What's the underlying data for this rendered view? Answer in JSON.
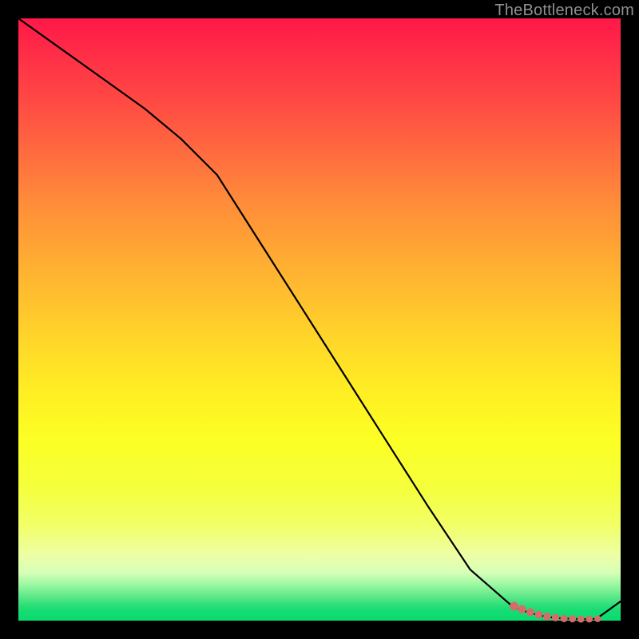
{
  "watermark": "TheBottleneck.com",
  "colors": {
    "page_bg": "#000000",
    "line": "#000000",
    "marker_fill": "#d76a6a",
    "marker_stroke": "#c95b5b",
    "gradient_top": "#ff1848",
    "gradient_bottom": "#0adb70"
  },
  "chart_data": {
    "type": "line",
    "title": "",
    "xlabel": "",
    "ylabel": "",
    "xlim": [
      0,
      100
    ],
    "ylim": [
      0,
      100
    ],
    "grid": false,
    "series": [
      {
        "name": "curve",
        "x": [
          0,
          7,
          14,
          21,
          27,
          33,
          40,
          47,
          54,
          61,
          68,
          75,
          82,
          84,
          86,
          88,
          90,
          92,
          94,
          96,
          100
        ],
        "y": [
          100,
          95,
          90,
          85,
          80,
          74,
          63,
          52,
          41,
          30,
          19,
          8.5,
          2.4,
          1.6,
          1.0,
          0.6,
          0.4,
          0.3,
          0.25,
          0.3,
          3.2
        ]
      }
    ],
    "markers": {
      "name": "highlight-flat-region",
      "x": [
        82.3,
        83.6,
        85.0,
        86.4,
        87.8,
        89.2,
        90.6,
        92.0,
        93.4,
        94.8,
        96.2
      ],
      "y": [
        2.4,
        1.9,
        1.4,
        1.0,
        0.7,
        0.5,
        0.35,
        0.3,
        0.25,
        0.25,
        0.3
      ],
      "r": [
        5.4,
        5.2,
        5.0,
        4.9,
        4.8,
        4.7,
        4.6,
        4.5,
        4.4,
        4.3,
        4.2
      ]
    }
  }
}
